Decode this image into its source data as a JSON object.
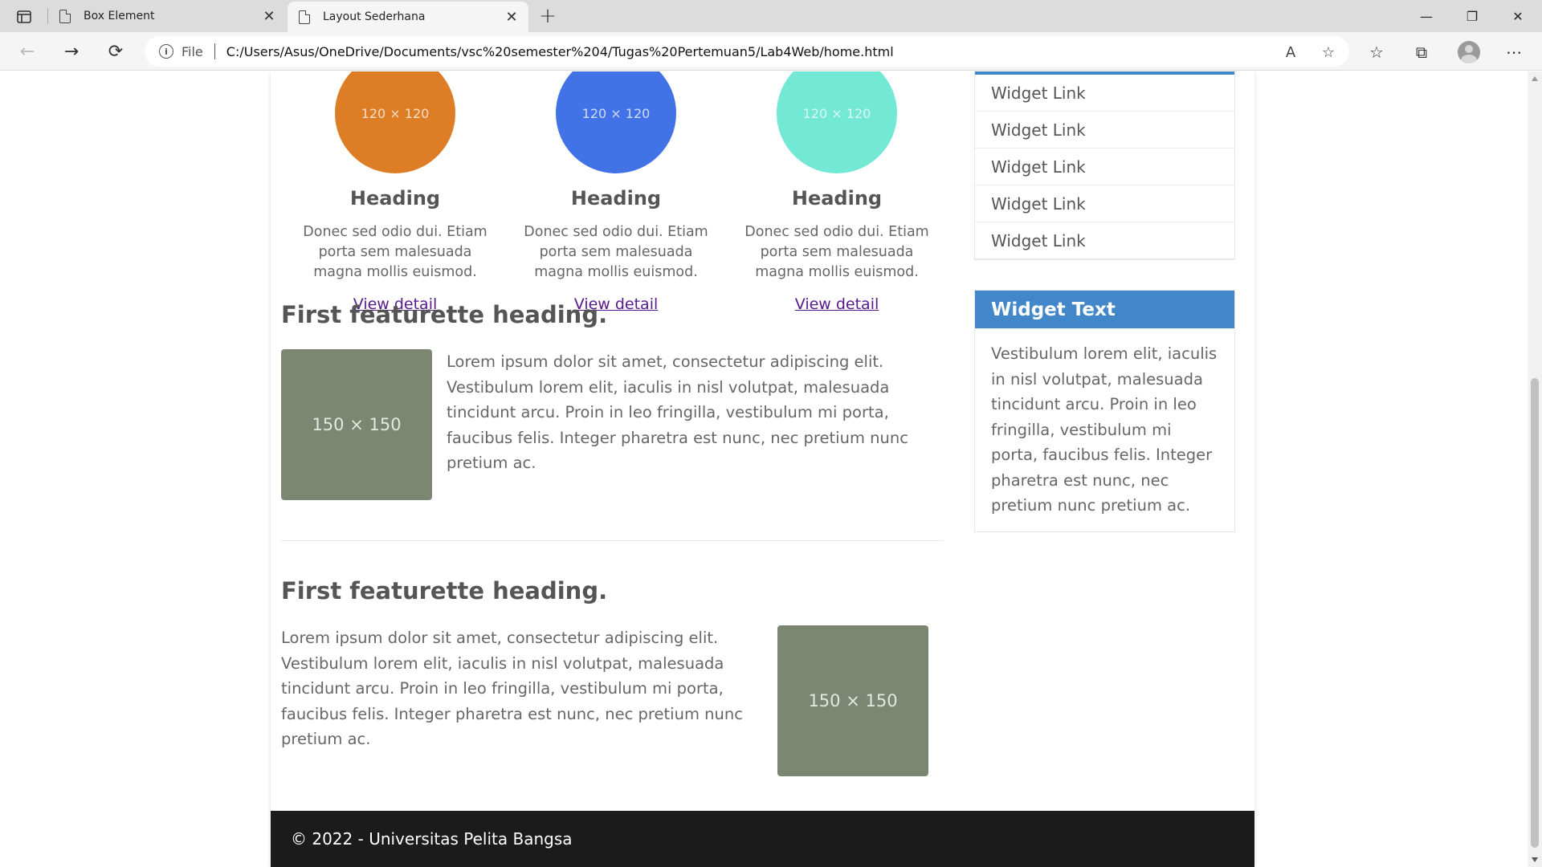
{
  "browser": {
    "tabs": [
      {
        "title": "Box Element",
        "close": "✕"
      },
      {
        "title": "Layout Sederhana",
        "close": "✕"
      }
    ],
    "new_tab": "+",
    "window_controls": {
      "minimize": "—",
      "restore": "❐",
      "close": "✕"
    },
    "address": {
      "info": "i",
      "scheme_label": "File",
      "url": "C:/Users/Asus/OneDrive/Documents/vsc%20semester%204/Tugas%20Pertemuan5/Lab4Web/home.html"
    },
    "nav": {
      "back": "←",
      "forward": "→",
      "refresh": "⟳"
    },
    "toolbar_icons": {
      "read_aloud": "A",
      "favorite_add": "☆",
      "favorites": "☆",
      "collections": "⧉",
      "more": "⋯"
    }
  },
  "page": {
    "columns": [
      {
        "image_label": "120 × 120",
        "color": "#dd7e26",
        "heading": "Heading",
        "text": "Donec sed odio dui. Etiam porta sem malesuada magna mollis euismod.",
        "link": "View detail"
      },
      {
        "image_label": "120 × 120",
        "color": "#4172e6",
        "heading": "Heading",
        "text": "Donec sed odio dui. Etiam porta sem malesuada magna mollis euismod.",
        "link": "View detail"
      },
      {
        "image_label": "120 × 120",
        "color": "#72e8d5",
        "heading": "Heading",
        "text": "Donec sed odio dui. Etiam porta sem malesuada magna mollis euismod.",
        "link": "View detail"
      }
    ],
    "featurettes": [
      {
        "heading": "First featurette heading.",
        "image_label": "150 × 150",
        "text": "Lorem ipsum dolor sit amet, consectetur adipiscing elit. Vestibulum lorem elit, iaculis in nisl volutpat, malesuada tincidunt arcu. Proin in leo fringilla, vestibulum mi porta, faucibus felis. Integer pharetra est nunc, nec pretium nunc pretium ac."
      },
      {
        "heading": "First featurette heading.",
        "image_label": "150 × 150",
        "text": "Lorem ipsum dolor sit amet, consectetur adipiscing elit. Vestibulum lorem elit, iaculis in nisl volutpat, malesuada tincidunt arcu. Proin in leo fringilla, vestibulum mi porta, faucibus felis. Integer pharetra est nunc, nec pretium nunc pretium ac."
      }
    ],
    "sidebar": {
      "links": [
        "Widget Link",
        "Widget Link",
        "Widget Link",
        "Widget Link",
        "Widget Link"
      ],
      "text_widget": {
        "title": "Widget Text",
        "body": "Vestibulum lorem elit, iaculis in nisl volutpat, malesuada tincidunt arcu. Proin in leo fringilla, vestibulum mi porta, faucibus felis. Integer pharetra est nunc, nec pretium nunc pretium ac."
      }
    },
    "footer": "© 2022 - Universitas Pelita Bangsa"
  }
}
